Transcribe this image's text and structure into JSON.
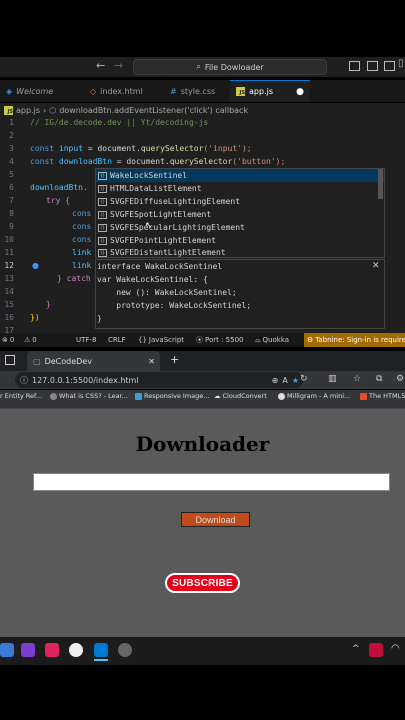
{
  "vscode": {
    "search_text": "File Dowloader",
    "tabs": [
      {
        "label": "Welcome"
      },
      {
        "label": "index.html"
      },
      {
        "label": "style.css"
      },
      {
        "label": "app.js"
      }
    ],
    "breadcrumb": {
      "file": "app.js",
      "symbol": "downloadBtn.addEventListener('click') callback"
    },
    "line_numbers": [
      "1",
      "2",
      "3",
      "4",
      "5",
      "6",
      "7",
      "8",
      "9",
      "10",
      "11",
      "12",
      "13",
      "14",
      "15",
      "16",
      "17"
    ],
    "code": {
      "l2": "// IG/de.decode.dev || Yt/decoding-js",
      "l4_kw": "const",
      "l4_var": "input",
      "l4_rest": " = document.",
      "l4_fn": "querySelector",
      "l4_str": "('input');",
      "l5_kw": "const",
      "l5_var": "downloadBtn",
      "l5_rest": " = document.",
      "l5_fn": "querySelector",
      "l5_str": "('button');",
      "l7": "downloadBtn.",
      "l8": "try {",
      "l9": "cons",
      "l10": "cons",
      "l11": "cons",
      "l12": "link",
      "l13": "link",
      "l14": "} catch (",
      "l16": "}",
      "l17": "})"
    },
    "suggestions": [
      "WakeLockSentinel",
      "HTMLDataListElement",
      "SVGFEDiffuseLightingElement",
      "SVGFESpotLightElement",
      "SVGFESpecularLightingElement",
      "SVGFEPointLightElement",
      "SVGFEDistantLightElement"
    ],
    "hover_lines": [
      "interface WakeLockSentinel",
      "var WakeLockSentinel: {",
      "    new (): WakeLockSentinel;",
      "    prototype: WakeLockSentinel;",
      "}"
    ],
    "status": {
      "problems": "0",
      "warnings": "0",
      "encoding": "UTF-8",
      "eol": "CRLF",
      "language": "JavaScript",
      "port": "Port : 5500",
      "quokka": "Quokka",
      "tabnine": "Tabnine: Sign-in is required"
    }
  },
  "browser": {
    "tab_title": "DeCodeDev",
    "url": "127.0.0.1:5500/index.html",
    "bookmarks": [
      "r Entity Ref...",
      "What is CSS? - Lear...",
      "Responsive Image...",
      "CloudConvert",
      "Milligram - A mini...",
      "The HTML5"
    ]
  },
  "page": {
    "title": "Downloader",
    "button_label": "Download",
    "subscribe_label": "SUBSCRIBE"
  },
  "colors": {
    "accent": "#0078d4",
    "download_button": "#c04a1a",
    "subscribe": "#e3001b",
    "tabnine": "#a36a00"
  }
}
